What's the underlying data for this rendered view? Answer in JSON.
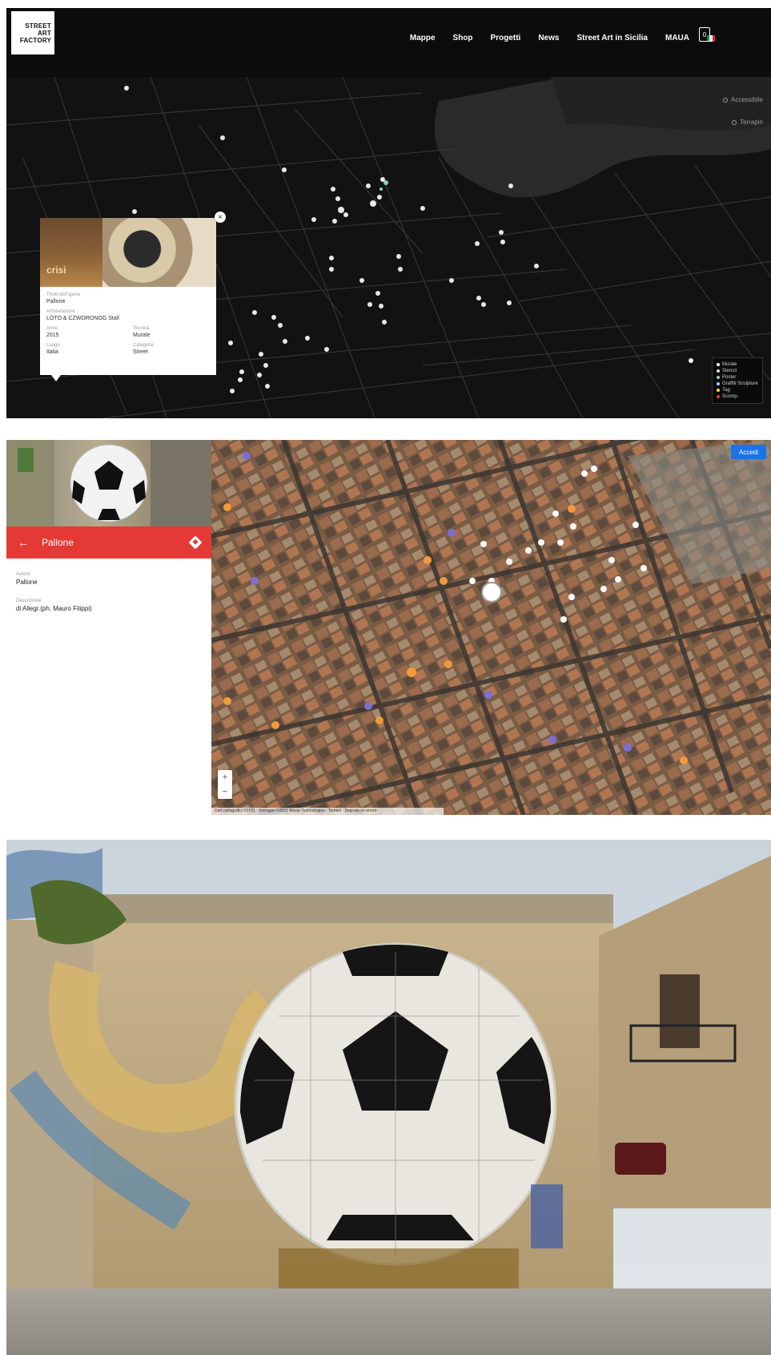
{
  "brand": {
    "logo_lines": [
      "STREET",
      "ART",
      "FACTORY"
    ]
  },
  "nav": {
    "items": [
      "Mappe",
      "Shop",
      "Progetti",
      "News",
      "Street Art in Sicilia",
      "MAUA"
    ],
    "cart_count": "0"
  },
  "colors": {
    "accent_red": "#e53935",
    "map_button_blue": "#1a73e8",
    "flag": [
      "#009246",
      "#ffffff",
      "#ce2b37"
    ]
  },
  "dark_map": {
    "layer_options": [
      "Accessibile",
      "Terrapin"
    ],
    "legend": [
      {
        "label": "Murale",
        "color": "#ffffff"
      },
      {
        "label": "Stencil",
        "color": "#dddddd"
      },
      {
        "label": "Poster",
        "color": "#bbbbbb"
      },
      {
        "label": "Graffiti Sculpture",
        "color": "#9ad2ff"
      },
      {
        "label": "Tag",
        "color": "#ffd54f"
      },
      {
        "label": "Scomp.",
        "color": "#e53935"
      }
    ],
    "popup": {
      "photo_caption": "crisi",
      "close_icon": "×",
      "fields": [
        {
          "label": "Titolo dell'opera",
          "value": "Pallone"
        },
        {
          "label": "Artista/autore",
          "value": "LOTO & CZWORONOG Stall"
        }
      ],
      "grid": [
        {
          "label": "Anno",
          "value": "2015"
        },
        {
          "label": "Tecnica",
          "value": "Murale"
        },
        {
          "label": "Luogo",
          "value": "Italia"
        },
        {
          "label": "Categoria",
          "value": "Street"
        }
      ]
    }
  },
  "sat_map": {
    "panel_title": "Pallone",
    "back_icon": "←",
    "fields": [
      {
        "label": "Autore",
        "value": "Pallone"
      },
      {
        "label": "Descrizione",
        "value": "di Allegr.(ph. Mauro Filippi)"
      }
    ],
    "view_button": "Accedi",
    "zoom_in": "+",
    "zoom_out": "−",
    "attribution": "Dati cartografici ©2021 · Immagini ©2021 Maxar Technologies · Termini · Segnala un errore"
  }
}
